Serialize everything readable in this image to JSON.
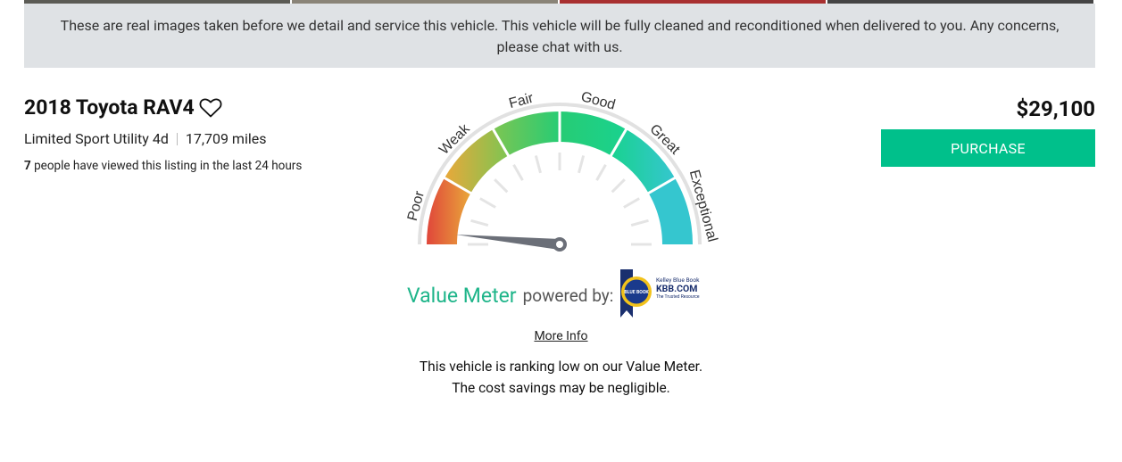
{
  "notice": {
    "text": "These are real images taken before we detail and service this vehicle. This vehicle will be fully cleaned and reconditioned when delivered to you. Any concerns, please chat with us."
  },
  "vehicle": {
    "title": "2018 Toyota RAV4",
    "trim": "Limited Sport Utility 4d",
    "mileage": "17,709 miles",
    "views_count": "7",
    "views_text": " people have viewed this listing in the last 24 hours",
    "price": "$29,100"
  },
  "actions": {
    "purchase_label": "PURCHASE",
    "favorite_icon": "heart-outline-icon"
  },
  "value_meter": {
    "segments": [
      "Poor",
      "Weak",
      "Fair",
      "Good",
      "Great",
      "Exceptional"
    ],
    "segment_colors": [
      "#e0463a",
      "#e9a83a",
      "#7dc552",
      "#27cc74",
      "#19d28f",
      "#35c6cf"
    ],
    "needle_level": 0.03,
    "title": "Value Meter",
    "powered_by": "powered by:",
    "kbb": {
      "badge_text": "BLUE BOOK",
      "brand_line": "Kelley Blue Book",
      "domain": "KBB.COM",
      "tagline": "The Trusted Resource"
    },
    "more_info_label": "More Info",
    "ranking_line1": "This vehicle is ranking low on our Value Meter.",
    "ranking_line2": "The cost savings may be negligible."
  },
  "colors": {
    "accent": "#00c08b",
    "notice_bg": "#dfe2e5",
    "value_meter_text": "#1fb58a"
  }
}
